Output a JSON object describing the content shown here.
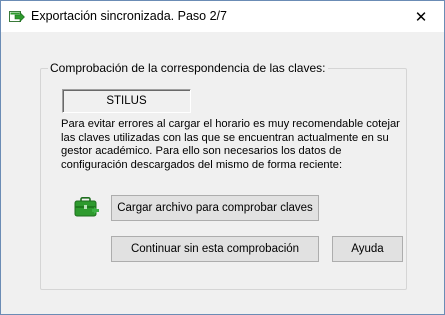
{
  "window": {
    "title": "Exportación sincronizada. Paso 2/7",
    "close_glyph": "✕"
  },
  "group": {
    "label": "Comprobación de la correspondencia de las claves:",
    "code_value": "STILUS",
    "description": "Para evitar errores al cargar el horario es muy recomendable cotejar las claves utilizadas con las que se encuentran actualmente en su gestor académico. Para ello son necesarios los datos de configuración descargados del mismo de forma reciente:"
  },
  "buttons": {
    "load_label": "Cargar archivo para comprobar claves",
    "continue_label": "Continuar sin esta comprobación",
    "help_label": "Ayuda"
  },
  "icons": {
    "title_icon": "export-arrow-icon",
    "bag_icon": "green-bag-icon"
  },
  "colors": {
    "accent_green": "#2e9a2e",
    "window_bg": "#f0f0f0",
    "button_bg": "#e1e1e1"
  }
}
